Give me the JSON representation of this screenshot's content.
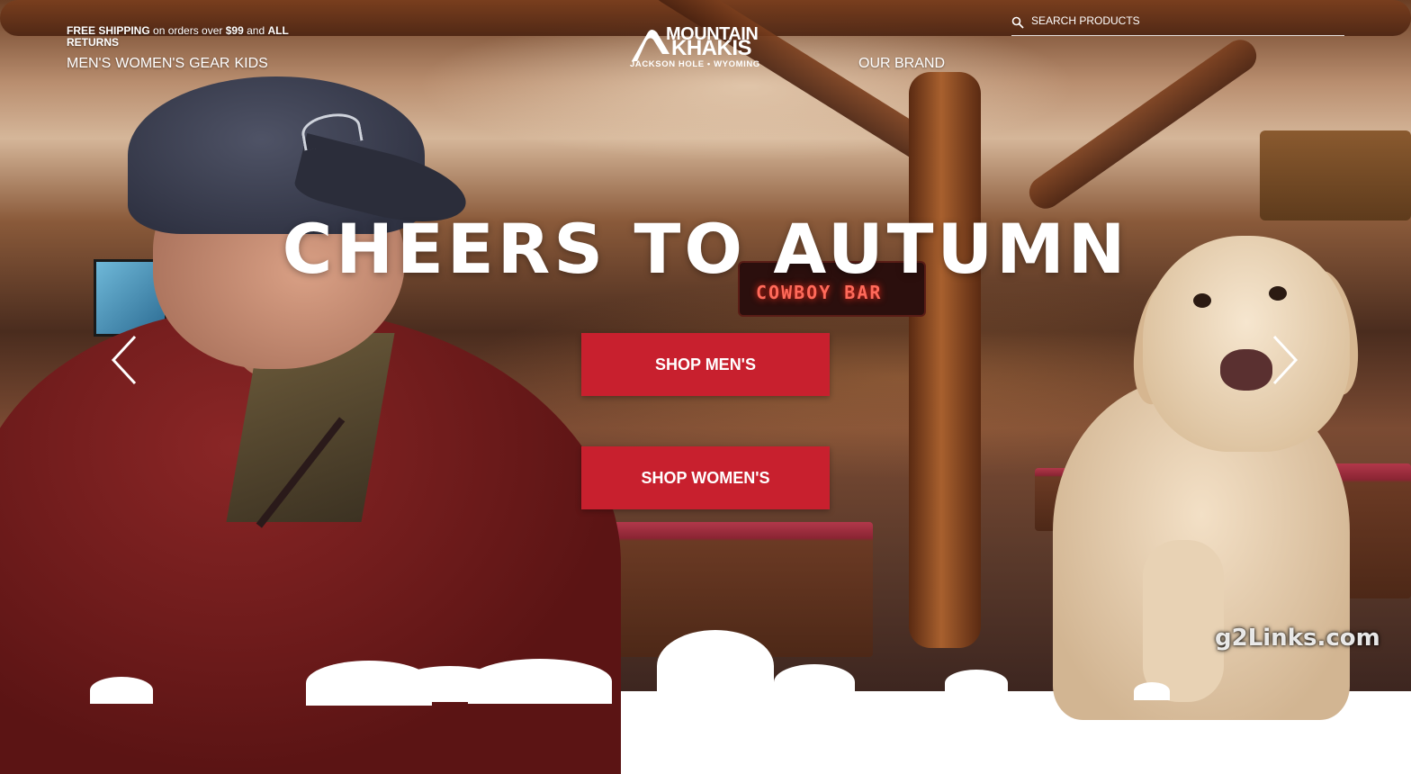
{
  "promo": {
    "part1": "FREE SHIPPING",
    "part2": " on orders over ",
    "part3": "$99",
    "part4": " and ",
    "part5": "ALL RETURNS"
  },
  "nav": {
    "left": [
      "MEN'S",
      "WOMEN'S",
      "GEAR",
      "KIDS"
    ],
    "right": "OUR BRAND"
  },
  "logo": {
    "line1": "MOUNTAIN",
    "line2": "KHAKIS",
    "sub": "JACKSON HOLE • WYOMING"
  },
  "search": {
    "placeholder": "SEARCH PRODUCTS"
  },
  "hero": {
    "title": "CHEERS TO AUTUMN",
    "cta_men": "SHOP MEN'S",
    "cta_women": "SHOP WOMEN'S",
    "sign_text": "COWBOY BAR"
  },
  "watermark": "g2Links.com",
  "colors": {
    "cta": "#c8202e",
    "text": "#ffffff"
  },
  "icons": {
    "search": "search-icon",
    "prev": "chevron-left-icon",
    "next": "chevron-right-icon"
  }
}
